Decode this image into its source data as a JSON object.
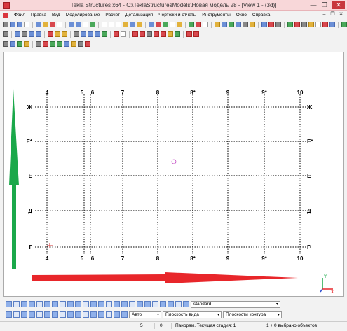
{
  "window": {
    "title": "Tekla Structures x64 - C:\\TeklaStructuresModels\\Новая модель 28  - [View 1 - (3d)]",
    "minimize": "—",
    "maximize": "❐",
    "close": "✕"
  },
  "menu": {
    "items": [
      "Файл",
      "Правка",
      "Вид",
      "Моделирование",
      "Расчет",
      "Детализация",
      "Чертежи и отчеты",
      "Инструменты",
      "Окно",
      "Справка"
    ]
  },
  "grid": {
    "columns": [
      "4",
      "5",
      "6",
      "7",
      "8",
      "8*",
      "9",
      "9*",
      "10"
    ],
    "bottom_columns": [
      "4",
      "5",
      "6",
      "7",
      "8",
      "8*",
      "9",
      "9*",
      "10"
    ],
    "rows": [
      "Ж",
      "Е*",
      "Е",
      "Д",
      "Г"
    ]
  },
  "bottom": {
    "standard_value": "standard",
    "auto_value": "Авто",
    "view_plane_value": "Плоскость вида",
    "contour_plane_value": "Плоскости контура"
  },
  "status": {
    "field_1": "5",
    "field_2": "0",
    "message": "Панорам. Текущая стадия: 1",
    "selection": "1 + 0 выбрано объектов"
  },
  "colors": {
    "axis_x": "#e8262a",
    "axis_y": "#1aa84a",
    "grid_line": "#000000",
    "title_bg": "#f8d7d9"
  },
  "icons": {
    "coordinate_icon": "xyz-axis-icon",
    "point_marker": "work-point-icon"
  }
}
